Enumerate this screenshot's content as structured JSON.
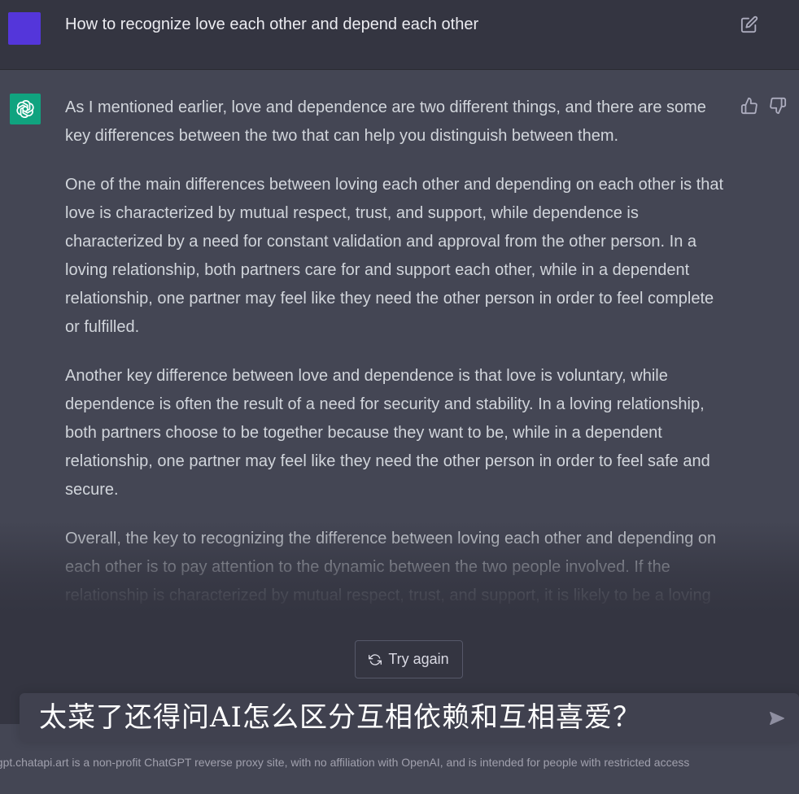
{
  "user_message": {
    "text": "How to recognize love each other and depend each other",
    "avatar_color": "#5436da",
    "edit_icon": "edit-icon"
  },
  "assistant_message": {
    "avatar_color": "#10a37f",
    "avatar_icon": "openai-logo-icon",
    "paragraphs": [
      "As I mentioned earlier, love and dependence are two different things, and there are some key differences between the two that can help you distinguish between them.",
      "One of the main differences between loving each other and depending on each other is that love is characterized by mutual respect, trust, and support, while dependence is characterized by a need for constant validation and approval from the other person. In a loving relationship, both partners care for and support each other, while in a dependent relationship, one partner may feel like they need the other person in order to feel complete or fulfilled.",
      "Another key difference between love and dependence is that love is voluntary, while dependence is often the result of a need for security and stability. In a loving relationship, both partners choose to be together because they want to be, while in a dependent relationship, one partner may feel like they need the other person in order to feel safe and secure.",
      "Overall, the key to recognizing the difference between loving each other and depending on each other is to pay attention to the dynamic between the two people involved. If the relationship is characterized by mutual respect, trust, and support, it is likely to be a loving relationship. If, on the other hand, the relationship is characterized by a need for constant validation and approval, it may be a dependent relationship."
    ],
    "thumbs_up_icon": "thumbs-up-icon",
    "thumbs_down_icon": "thumbs-down-icon"
  },
  "try_again": {
    "label": "Try again",
    "icon": "refresh-icon"
  },
  "composer": {
    "value": "太菜了还得问AI怎么区分互相依赖和互相喜爱？",
    "send_icon": "send-icon"
  },
  "footer": {
    "text": "//gpt.chatapi.art is a non-profit ChatGPT reverse proxy site, with no affiliation with OpenAI, and is intended for people with restricted access"
  },
  "colors": {
    "page_bg": "#343541",
    "assistant_bg": "#444654",
    "input_bg": "#40414f"
  }
}
